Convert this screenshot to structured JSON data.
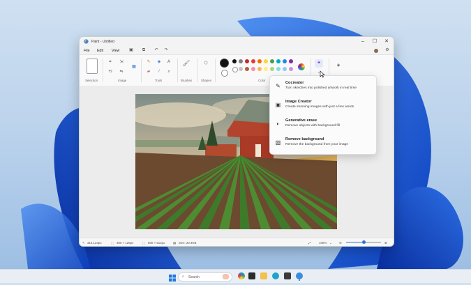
{
  "window": {
    "title": "Paint - Untitled",
    "menu": [
      "File",
      "Edit",
      "View"
    ]
  },
  "ribbon": {
    "groups": [
      "Selection",
      "Image",
      "Tools",
      "Brushes",
      "Shapes",
      "Color"
    ]
  },
  "palette": {
    "row1": [
      "#111111",
      "#7f7f7f",
      "#c62828",
      "#e53935",
      "#ef6c00",
      "#fdd835",
      "#43a047",
      "#00acc1",
      "#1e88e5",
      "#8e24aa"
    ],
    "row2": [
      "#ffffff",
      "#c3c3c3",
      "#b85c38",
      "#f48fb1",
      "#ffb74d",
      "#fff176",
      "#aed581",
      "#80deea",
      "#90caf9",
      "#ce93d8"
    ],
    "primary": "#111111",
    "secondary": "#ffffff"
  },
  "copilot_menu": {
    "items": [
      {
        "title": "Cocreator",
        "desc": "Turn sketches into polished artwork in real time",
        "icon": "cocreator-icon"
      },
      {
        "title": "Image Creator",
        "desc": "Create stunning images with just a few words",
        "icon": "image-creator-icon"
      },
      {
        "title": "Generative erase",
        "desc": "Remove objects with background fill",
        "icon": "generative-erase-icon"
      },
      {
        "title": "Remove background",
        "desc": "Remove the background from your image",
        "icon": "remove-background-icon"
      }
    ]
  },
  "status": {
    "cursor": "314,124px",
    "selection": "300 × 125px",
    "canvas": "800 × 512px",
    "size": "Size: 20.4KB",
    "zoom": "100%",
    "zoom_level": 0.5
  },
  "taskbar": {
    "search_placeholder": "Search"
  }
}
